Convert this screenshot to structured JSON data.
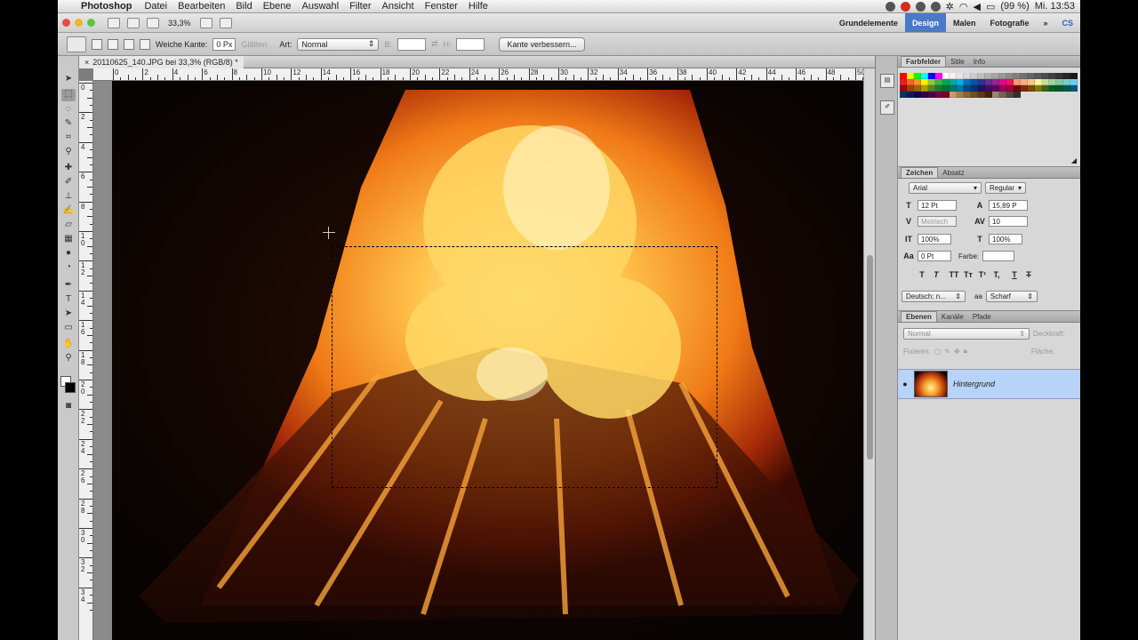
{
  "menubar": {
    "app_name": "Photoshop",
    "items": [
      "Datei",
      "Bearbeiten",
      "Bild",
      "Ebene",
      "Auswahl",
      "Filter",
      "Ansicht",
      "Fenster",
      "Hilfe"
    ],
    "battery": "(99 %)",
    "clock": "Mi. 13:53"
  },
  "appbar": {
    "zoom": "33,3%",
    "workspaces": [
      "Grundelemente",
      "Design",
      "Malen",
      "Fotografie"
    ],
    "active_workspace": "Design",
    "more": "»",
    "cs": "CS"
  },
  "options": {
    "feather_label": "Weiche Kante:",
    "feather_value": "0 Px",
    "antialias_label": "Glätten",
    "style_label": "Art:",
    "style_value": "Normal",
    "width_label": "B:",
    "height_label": "H:",
    "refine_button": "Kante verbessern..."
  },
  "document": {
    "tab_title": "20110625_140.JPG bei 33,3% (RGB/8) *",
    "close": "×",
    "h_ruler_labels": [
      "0",
      "2",
      "4",
      "6",
      "8",
      "10",
      "12",
      "14",
      "16",
      "18",
      "20",
      "22",
      "24",
      "26",
      "28",
      "30",
      "32",
      "34",
      "36",
      "38",
      "40",
      "42",
      "44",
      "46",
      "48",
      "50"
    ],
    "v_ruler_labels": [
      "0",
      "2",
      "4",
      "6",
      "8",
      "10",
      "12",
      "14",
      "16",
      "18",
      "20",
      "22",
      "24",
      "26",
      "28",
      "30",
      "32",
      "34"
    ],
    "colors": {
      "fire_core": "#ffe27a",
      "fire_mid": "#f59a1f",
      "fire_dark": "#b8330a",
      "background": "#070302"
    }
  },
  "swatches_panel": {
    "tabs": [
      "Farbfelder",
      "Stile",
      "Info"
    ],
    "active_tab": "Farbfelder",
    "colors": [
      "#ff0000",
      "#ffff00",
      "#00ff00",
      "#00ffff",
      "#0000ff",
      "#ff00ff",
      "#ffffff",
      "#f2f2f2",
      "#e6e6e6",
      "#d9d9d9",
      "#cccccc",
      "#bfbfbf",
      "#b3b3b3",
      "#a6a6a6",
      "#999999",
      "#8c8c8c",
      "#808080",
      "#737373",
      "#666666",
      "#595959",
      "#4d4d4d",
      "#404040",
      "#333333",
      "#262626",
      "#1a1a1a",
      "#ed1c24",
      "#f26522",
      "#f7941d",
      "#fff200",
      "#8dc63f",
      "#39b54a",
      "#00a651",
      "#00a99d",
      "#00aeef",
      "#0072bc",
      "#0054a6",
      "#2e3192",
      "#662d91",
      "#92278f",
      "#ec008c",
      "#ed145b",
      "#f69679",
      "#f9ad81",
      "#fdc689",
      "#fff799",
      "#c4df9b",
      "#a3d39c",
      "#82ca9c",
      "#7accc8",
      "#6dcff6",
      "#9e0b0f",
      "#a0410d",
      "#a3620a",
      "#aba000",
      "#598527",
      "#1a7b30",
      "#007236",
      "#00746b",
      "#0076a3",
      "#004a80",
      "#003471",
      "#1b1464",
      "#440e62",
      "#630460",
      "#9e005d",
      "#9e0039",
      "#790000",
      "#7b2e00",
      "#7d4900",
      "#827b00",
      "#406618",
      "#005e20",
      "#005826",
      "#005952",
      "#005b7f",
      "#003663",
      "#002157",
      "#0d004c",
      "#32004b",
      "#4b0049",
      "#7b0046",
      "#7a0026",
      "#c69c6d",
      "#a67c52",
      "#8c6239",
      "#754c24",
      "#603913",
      "#42210b",
      "#998675",
      "#736357",
      "#534741",
      "#362f2d"
    ]
  },
  "character_panel": {
    "tabs": [
      "Zeichen",
      "Absatz"
    ],
    "active_tab": "Zeichen",
    "font_family": "Arial",
    "font_style": "Regular",
    "font_size": "12 Pt",
    "leading": "15,89 P",
    "kerning": "Metrisch",
    "tracking": "10",
    "vertical_scale": "100%",
    "horizontal_scale": "100%",
    "baseline_shift": "0 Pt",
    "color_label": "Farbe:",
    "style_buttons": [
      "T",
      "T",
      "TT",
      "Tт",
      "T¹",
      "T,",
      "T",
      "T"
    ],
    "language": "Deutsch: n...",
    "antialiasing_icon": "aa",
    "antialiasing": "Scharf"
  },
  "layers_panel": {
    "tabs": [
      "Ebenen",
      "Kanäle",
      "Pfade"
    ],
    "active_tab": "Ebenen",
    "blend_mode": "Normal",
    "opacity_label": "Deckkraft:",
    "lock_label": "Fixieren:",
    "fill_label": "Fläche:",
    "layer_name": "Hintergrund"
  }
}
